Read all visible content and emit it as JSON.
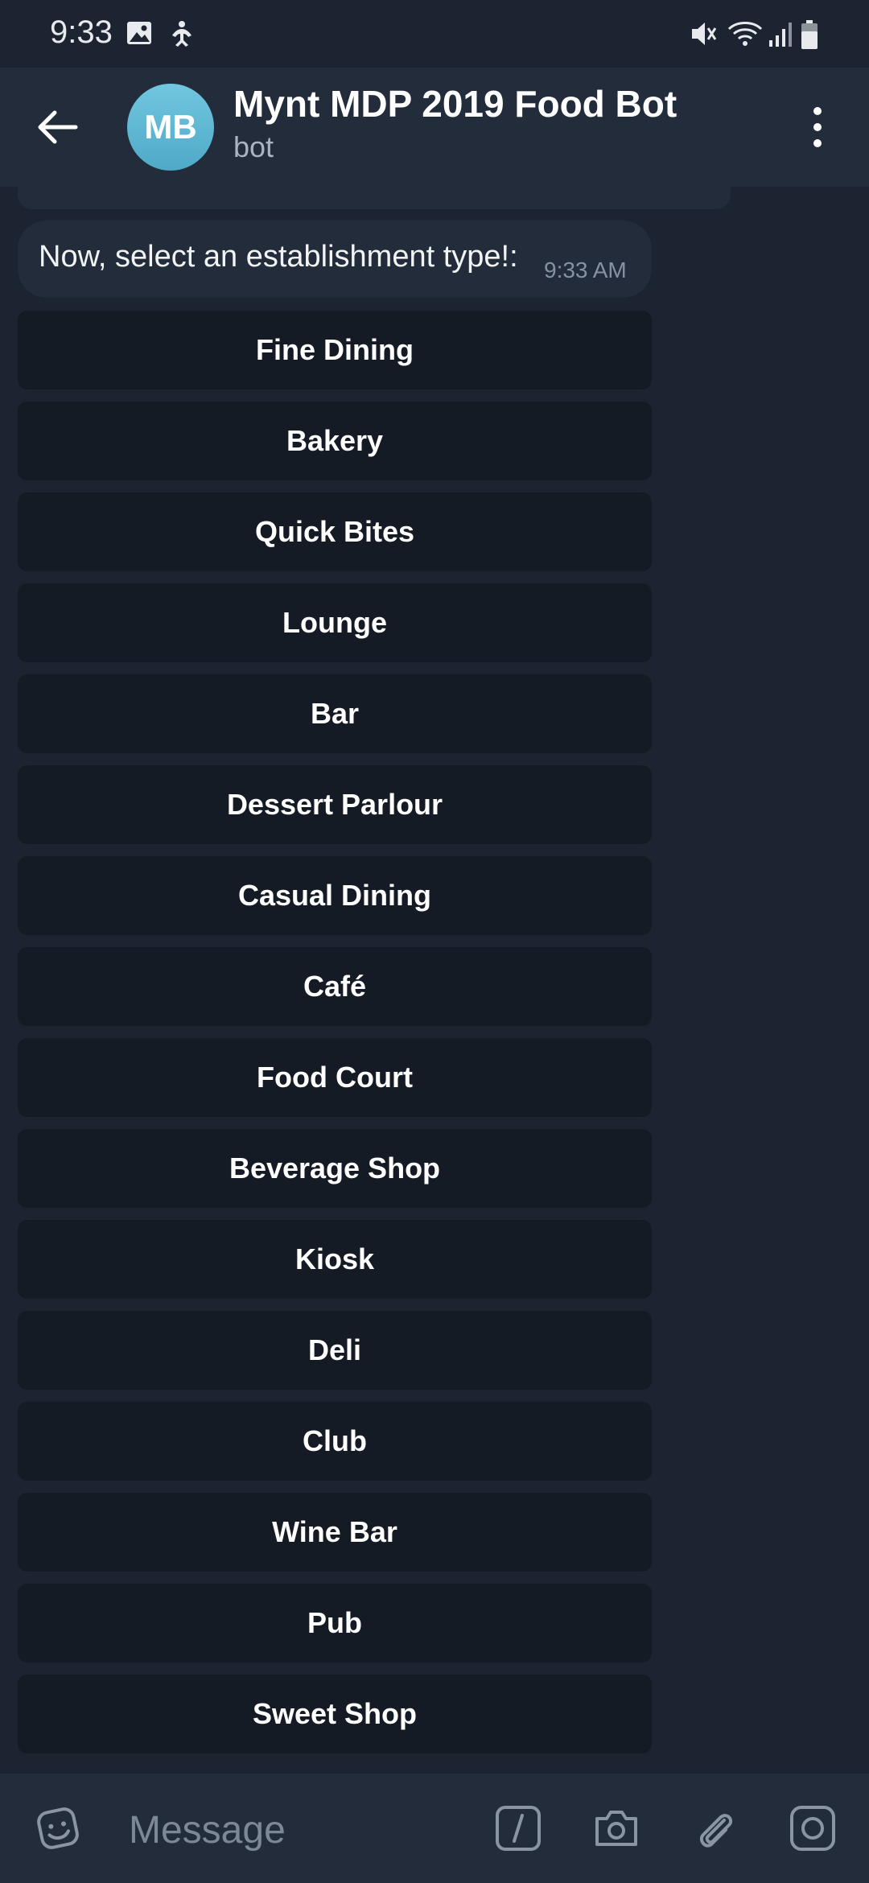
{
  "status_bar": {
    "time": "9:33",
    "icons": [
      "gallery-icon",
      "accessibility-icon",
      "mute-icon",
      "wifi-icon",
      "signal-icon",
      "battery-icon"
    ]
  },
  "header": {
    "avatar_initials": "MB",
    "title": "Mynt MDP 2019 Food Bot",
    "subtitle": "bot",
    "icons": [
      "back-arrow-icon",
      "more-vertical-icon"
    ]
  },
  "message": {
    "text": "Now, select an establishment type!:",
    "time": "9:33 AM"
  },
  "keyboard": {
    "buttons": [
      "Fine Dining",
      "Bakery",
      "Quick Bites",
      "Lounge",
      "Bar",
      "Dessert Parlour",
      "Casual Dining",
      "Café",
      "Food Court",
      "Beverage Shop",
      "Kiosk",
      "Deli",
      "Club",
      "Wine Bar",
      "Pub",
      "Sweet Shop"
    ]
  },
  "input_bar": {
    "placeholder": "Message",
    "icons": [
      "emoji-icon",
      "bot-command-icon",
      "camera-icon",
      "attach-icon",
      "instagram-icon"
    ]
  },
  "colors": {
    "background": "#1c2331",
    "header": "#222c3a",
    "button": "#151b25",
    "avatar": "#5fb8d4"
  }
}
